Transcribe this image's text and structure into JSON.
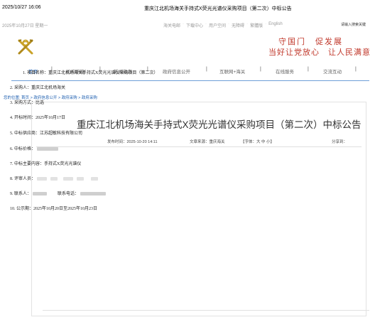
{
  "print_header": {
    "timestamp": "2025/10/27 16:06",
    "title": "重庆江北机场海关手持式X荧光光谱仪采购项目（第二次）中标公告"
  },
  "topbar": {
    "date": "2025年10月27日 星期一",
    "links": [
      "海关电邮",
      "下载中心",
      "用户空间",
      "无障碍",
      "繁體版",
      "English"
    ],
    "search_hint": "请输入搜索关键"
  },
  "slogan": {
    "line1": "守国门　促发展",
    "line2": "当好让党放心　让人民满意"
  },
  "nav": {
    "items": [
      "首页",
      "机构职能",
      "新闻动态",
      "政府信息公开",
      "互联网+海关",
      "在线服务",
      "交流互动"
    ]
  },
  "breadcrumb": "您的位置: 首页 > 政府信息公开 > 政府采购 > 政府采购",
  "article": {
    "title": "重庆江北机场海关手持式X荧光光谱仪采购项目（第二次）中标公告",
    "publish_time": "发布时间：2025-10-20 14:11",
    "source": "文章来源：重庆海关",
    "font_size": "【字体：大 中 小】",
    "share": "分享到："
  },
  "content": {
    "l1": "1. 项目名称：重庆江北机场海关手持式X荧光光谱仪采购项目（第二次）",
    "l2": "2. 采购人：重庆江北机场海关",
    "l3": "3. 采购方式：比选",
    "l4": "4. 开标时间：2025年10月17日",
    "l5": "5. 中标供应商：江苏超敏科技有限公司",
    "l6": "6. 中标价格：",
    "l7": "7. 中标主要内容：手持式X荧光光谱仪",
    "l8": "8. 评审人员：",
    "l9a": "9. 联系人：",
    "l9b": "联系电话：",
    "l10": "10. 公示期：2025年10月20日至2025年10月23日"
  },
  "colors": {
    "accent_blue": "#1e5fb0",
    "slogan_red": "#c0382b",
    "emblem_gold": "#c9a227"
  }
}
